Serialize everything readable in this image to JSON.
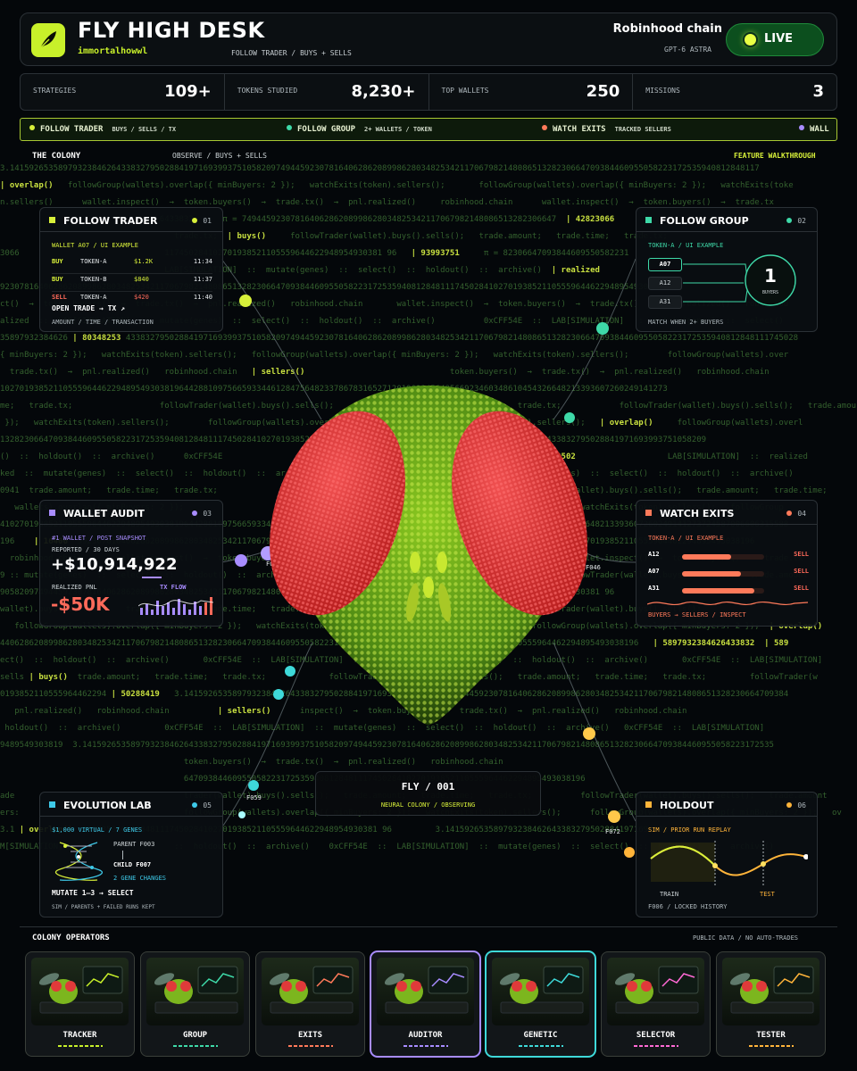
{
  "header": {
    "title": "FLY HIGH DESK",
    "handle": "immortalhowwl",
    "subnav": "FOLLOW TRADER / BUYS + SELLS",
    "chain": "Robinhood chain",
    "model": "GPT-6 ASTRA",
    "live_label": "LIVE"
  },
  "stats": [
    {
      "label": "STRATEGIES",
      "value": "109+"
    },
    {
      "label": "TOKENS STUDIED",
      "value": "8,230+"
    },
    {
      "label": "TOP WALLETS",
      "value": "250"
    },
    {
      "label": "MISSIONS",
      "value": "3"
    }
  ],
  "ribbon": [
    {
      "label": "FOLLOW TRADER",
      "sub": "BUYS / SELLS / TX",
      "color": "#d8f03a"
    },
    {
      "label": "FOLLOW GROUP",
      "sub": "2+ WALLETS / TOKEN",
      "color": "#3ed9a8"
    },
    {
      "label": "WATCH EXITS",
      "sub": "TRACKED SELLERS",
      "color": "#ff7a5a"
    },
    {
      "label": "WALL",
      "sub": "",
      "color": "#a88cff"
    }
  ],
  "colony": {
    "title": "THE COLONY",
    "subtitle": "OBSERVE / BUYS + SELLS",
    "walkthrough": "FEATURE WALKTHROUGH"
  },
  "code_lines": [
    "3.14159265358979323846264338327950288419716939937510582097494459230781640628620899862803482534211706798214808651328230664709384460955058223172535940812848117",
    "| overlap()   followGroup(wallets).overlap({ minBuyers: 2 });   watchExits(token).sellers();       followGroup(wallets).overlap({ minBuyers: 2 });   watchExits(toke",
    "n.sellers()      wallet.inspect()  →  token.buyers()  →  trade.tx()  →  pnl.realized()     robinhood.chain      wallet.inspect()  →  token.buyers()  →  trade.tx",
    "                                 6433832      π = 74944592307816406286208998628034825342117067982148086513282306647  | 42823066",
    "                                    trade.tx;  | buys()     followTrader(wallet).buys().sells();   trade.amount;   trade.time;   trade.tx;",
    "3066                              117450284102701938521105559644622948954930381 96   | 93993751     π = 82306647093844609550582231",
    "                                  LAB[SIMULATION]  ::  mutate(genes)  ::  select()  ::  holdout()  ::  archive()  | realized",
    "92307816406286208998628034825342117067982148086513282306647093844609550582231725359408128481117450284102701938521105559644622948954930381",
    "ct()  →  token.buyers()  →  trade.tx()  →  pnl.realized()   robinhood.chain       wallet.inspect()  →  token.buyers()  →  trade.tx()  →  pnl.realized()   robinhood",
    "alized  ::  LAB[SIMULATION]  ::  mutate(genes)  ::  select()  ::  holdout()  ::  archive()          0xCFF54E  ::  LAB[SIMULATION]  ::  mutate(genes)  ::  select()",
    "35897932384626 | 80348253 4338327950288419716939937510582097494459230781640628620899862803482534211706798214808651328230664709384460955058223172535940812848111745028",
    "{ minBuyers: 2 });   watchExits(token).sellers();   followGroup(wallets).overlap({ minBuyers: 2 });   watchExits(token).sellers();        followGroup(wallets).over",
    "  trade.tx()  →  pnl.realized()   robinhood.chain   | sellers()                              token.buyers()  →  trade.tx()  →  pnl.realized()   robinhood.chain",
    "102701938521105559644622948954930381964428810975665933446128475648233786783165271201909145648566923460348610454326648213393607260249141273",
    "me;   trade.tx;                  followTrader(wallet).buys().sells();        trade.amount;   trade.time;   trade.tx;            followTrader(wallet).buys().sells();   trade.amou",
    " });   watchExits(token).sellers();        followGroup(wallets).overlap({ minBuyers: 2 });   watchExits(token).sellers();   | overlap()     followGroup(wallets).overl",
    "1328230664709384460955058223172535940812848111745028410270193852110555964462294895493038196         5897932384626433832795028841971693993751058209",
    "()  ::  holdout()  ::  archive()      0xCFF54E                                                               | 83279502                   LAB[SIMULATION]  ::  realized",
    "ked  ::  mutate(genes)  ::  select()  ::  holdout()  ::  archive()      0xCFF54E  ::  LAB[SIMULATION]  ::  mutate(genes)  ::  select()  ::  holdout()  ::  archive()",
    "0941  trade.amount;   trade.time;   trade.tx;                                                                  trader(wallet).buys().sells();   trade.amount;   trade.time;",
    "   wallets).overlap({ minBuyers: 2 });                                                                                  watchExits(token).sellers();   followGroup",
    "4102701938521105559644622948954930381964428810975665933446128475                                                     4326648213393607260249141273724587006606315588",
    "196    | 16406  59230781640628620899862803482534211706798214808651328230664709384460955058223172535940812848111745028410270193852110555964462294895493038196",
    "  robinhood.chain       wallet.inspect()  →  token.buyers()  →  trade.tx()  →  pnl.realized()    robinhood.chain      wallet.inspect()  →  token.buyers()  →  trade.tx",
    "9 :: mutate(genes)  ::  select()  ::  holdout()  ::  archive()   ; trade.amount;   trade.time;   trade.tx;          followTrader(wallet).buys().sells();   trade.amount",
    "9058209749445923078164062862089986280348253421170679821480865132   | 25342117  117450284102701938521105559644622948954930381 96",
    "wallet).buys().sells();   trade.amount;   trade.time;   trade.tx;                               | buys()     followTrader(wallet).buys().sells();",
    "   followGroup(wallets).overlap({ minBuyers: 2 });   watchExits(token).sellers();                             followGroup(wallets).overlap({ minBuyers: 2 });  | overlap()",
    "440628620899862803482534211706798214808651328230664709384460955058223172535940812848111745028410270193852110555964462294895493038196   | 5897932384626433832  | 589",
    "ect()  ::  holdout()  ::  archive()       0xCFF54E  ::  LAB[SIMULATION]  ::  mutate(genes)  ::  select()  ::  holdout()  ::  archive()       0xCFF54E  ::  LAB[SIMULATION]",
    "sells | buys()  trade.amount;   trade.time;   trade.tx;             followTrader(wallet).buys().sells();   trade.amount;   trade.time;   trade.tx;         followTrader(w",
    "0193852110555964462294 | 50288419   3.14159265358979323846264338327950288419716939937510582097494459230781640628620899862803482534211706798214808651328230664709384",
    "   pnl.realized()   robinhood.chain          | sellers()      inspect()  →  token.buyers()  →  trade.tx()  →  pnl.realized()   robinhood.chain",
    " holdout()  ::  archive()         0xCFF54E  ::  LAB[SIMULATION]  ::  mutate(genes)  ::  select()  ::  holdout()  ::  archive()   0xCFF54E  ::  LAB[SIMULATION]",
    "9489549303819  3.14159265358979323846264338327950288419716939937510582097494459230781640628620899862803482534211706798214808651328230664709384460955058223172535",
    "                                      token.buyers()  →  trade.tx()  →  pnl.realized()   robinhood.chain",
    "                                      64709384460955058223172535940812848111745028410270193852110555964462294895493038196",
    "ade                                   trader(wallet).buys().sells();   trade.amount;   trade.time;   trade.tx;          followTrader(wallet).buys().sells();   trade.amount",
    "ers:                                  followGroup(wallets).overlap({ minBuyers: 2 });   watchExits(token).sellers();      followGroup(wallets).overlap({ minBuyers: 2 });   ov",
    "3.1 | overlap()  1725359408128481117450284102701938521105559644622948954930381 96         3.1415926535897932384626433832795028841971693993",
    "M[SIMULATION]                       ::  holdout()  ::  archive()    0xCFF54E  ::  LAB[SIMULATION]  ::  mutate(genes)  ::  select()  ::  holdout()  ::  archive()"
  ],
  "panels": {
    "follow_trader": {
      "title": "FOLLOW TRADER",
      "num": "01",
      "accent": "#d8f03a",
      "wallet_label": "WALLET A07 / UI EXAMPLE",
      "rows": [
        {
          "side": "BUY",
          "token": "TOKEN-A",
          "amount": "$1.2K",
          "time": "11:34"
        },
        {
          "side": "BUY",
          "token": "TOKEN-B",
          "amount": "$840",
          "time": "11:37"
        },
        {
          "side": "SELL",
          "token": "TOKEN-A",
          "amount": "$420",
          "time": "11:40"
        }
      ],
      "cta": "OPEN TRADE → TX ↗",
      "caption": "AMOUNT / TIME / TRANSACTION"
    },
    "follow_group": {
      "title": "FOLLOW GROUP",
      "num": "02",
      "accent": "#3ed9a8",
      "token_label": "TOKEN-A / UI EXAMPLE",
      "wallets": [
        "A07",
        "A12",
        "A31"
      ],
      "buyers_count": "1",
      "buyers_label": "BUYERS",
      "caption": "MATCH WHEN 2+ BUYERS"
    },
    "wallet_audit": {
      "title": "WALLET AUDIT",
      "num": "03",
      "accent": "#a88cff",
      "label": "#1 WALLET / POST SNAPSHOT",
      "reported": "REPORTED / 30 DAYS",
      "reported_value": "+$10,914,922",
      "realized_label": "REALIZED PNL",
      "realized_value": "-$50K",
      "tx_label": "TX FLOW"
    },
    "watch_exits": {
      "title": "WATCH EXITS",
      "num": "04",
      "accent": "#ff7a5a",
      "token_label": "TOKEN-A / UI EXAMPLE",
      "rows": [
        {
          "wallet": "A12",
          "action": "SELL",
          "level": 0.6
        },
        {
          "wallet": "A07",
          "action": "SELL",
          "level": 0.72
        },
        {
          "wallet": "A31",
          "action": "SELL",
          "level": 0.88
        }
      ],
      "caption": "BUYERS → SELLERS / INSPECT"
    },
    "evolution_lab": {
      "title": "EVOLUTION LAB",
      "num": "05",
      "accent": "#3ec9e8",
      "label": "$1,000 VIRTUAL / 7 GENES",
      "parent": "PARENT F003",
      "child": "CHILD F007",
      "changes": "2 GENE CHANGES",
      "cta": "MUTATE 1–3 → SELECT",
      "caption": "SIM / PARENTS + FAILED RUNS KEPT"
    },
    "holdout": {
      "title": "HOLDOUT",
      "num": "06",
      "accent": "#ffb43a",
      "label": "SIM / PRIOR RUN REPLAY",
      "train": "TRAIN",
      "test": "TEST",
      "caption": "F006 / LOCKED HISTORY"
    }
  },
  "fly_card": {
    "title": "FLY / 001",
    "subtitle": "NEURAL COLONY / OBSERVING"
  },
  "markers": [
    "F033",
    "F046",
    "F059",
    "F072"
  ],
  "operators": {
    "title": "COLONY OPERATORS",
    "note": "PUBLIC DATA / NO AUTO-TRADES",
    "items": [
      {
        "name": "TRACKER",
        "color": "#c8f02a",
        "highlight": false
      },
      {
        "name": "GROUP",
        "color": "#3ed9a8",
        "highlight": false
      },
      {
        "name": "EXITS",
        "color": "#ff7a5a",
        "highlight": false
      },
      {
        "name": "AUDITOR",
        "color": "#a88cff",
        "highlight": true
      },
      {
        "name": "GENETIC",
        "color": "#3ed9d9",
        "highlight": true
      },
      {
        "name": "SELECTOR",
        "color": "#ff6ad5",
        "highlight": false
      },
      {
        "name": "TESTER",
        "color": "#ffb43a",
        "highlight": false
      }
    ]
  }
}
